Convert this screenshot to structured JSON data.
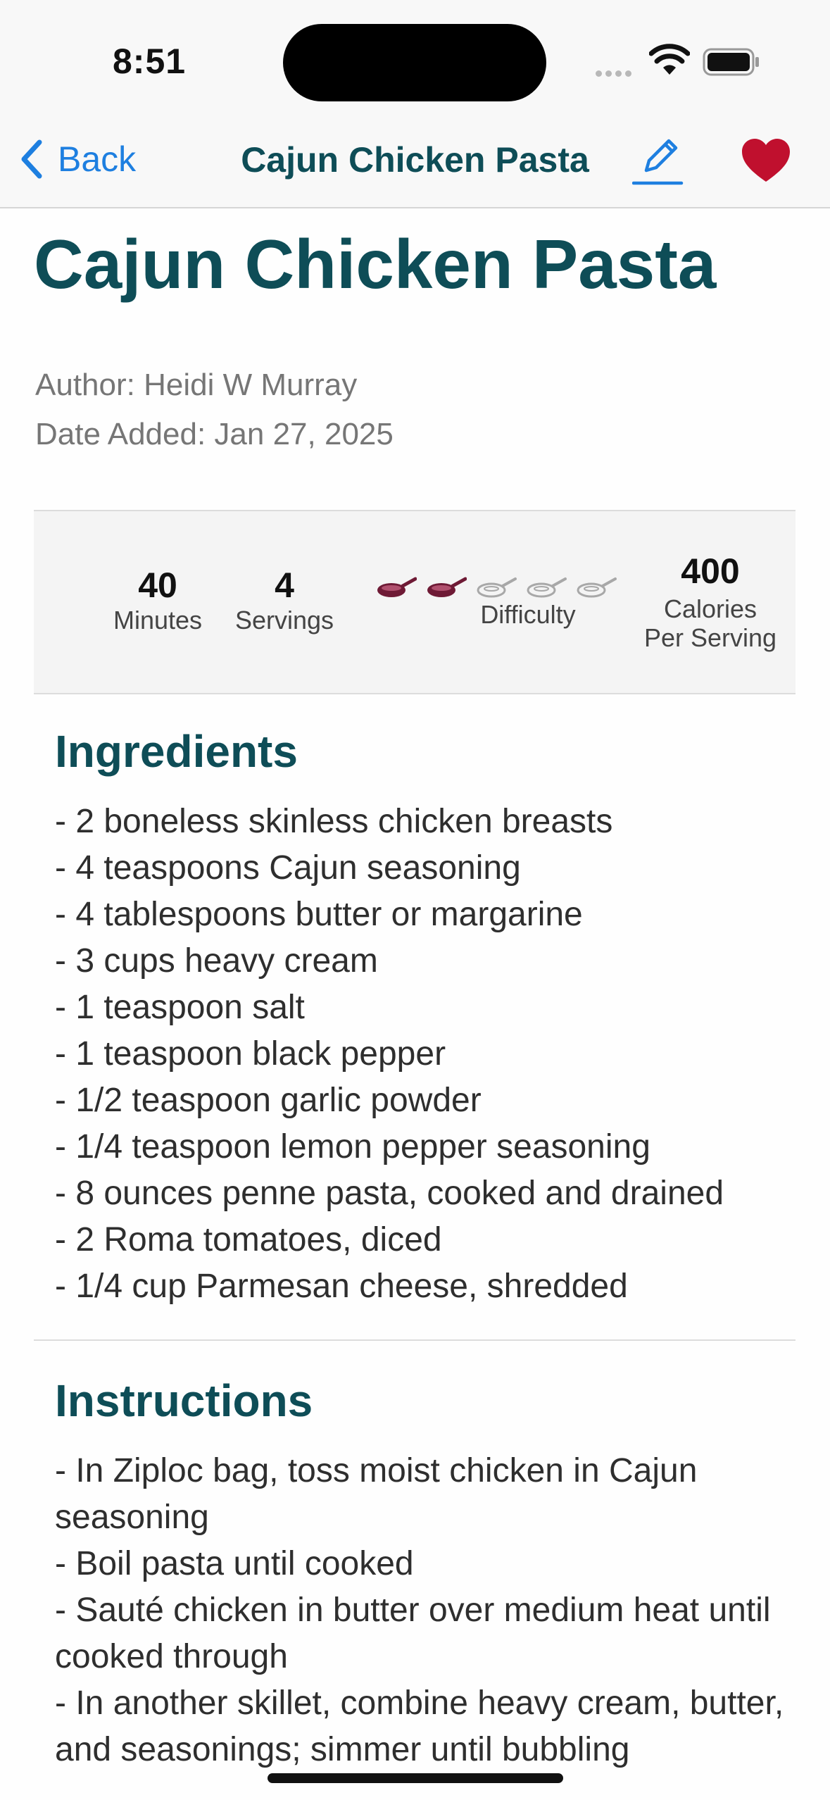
{
  "status_bar": {
    "time": "8:51",
    "icons": [
      "cellular-signal-icon",
      "wifi-icon",
      "battery-icon"
    ]
  },
  "nav": {
    "back_label": "Back",
    "title": "Cajun Chicken Pasta",
    "edit_icon": "pencil-icon",
    "favorite_icon": "heart-icon"
  },
  "recipe": {
    "title": "Cajun Chicken Pasta",
    "author": "Author: Heidi W Murray",
    "date_added": "Date Added: Jan 27, 2025"
  },
  "stats": {
    "minutes_value": "40",
    "minutes_label": "Minutes",
    "servings_value": "4",
    "servings_label": "Servings",
    "difficulty_label": "Difficulty",
    "difficulty_level": 2,
    "difficulty_max": 5,
    "calories_value": "400",
    "calories_label_line1": "Calories",
    "calories_label_line2": "Per Serving"
  },
  "ingredients": {
    "title": "Ingredients",
    "items": [
      "- 2 boneless skinless chicken breasts",
      "- 4 teaspoons Cajun seasoning",
      "- 4 tablespoons butter or margarine",
      "- 3 cups heavy cream",
      "- 1 teaspoon salt",
      "- 1 teaspoon black pepper",
      "- 1/2 teaspoon garlic powder",
      "- 1/4 teaspoon lemon pepper seasoning",
      "- 8 ounces penne pasta, cooked and drained",
      "- 2 Roma tomatoes, diced",
      "- 1/4 cup Parmesan cheese, shredded"
    ]
  },
  "instructions": {
    "title": "Instructions",
    "items": [
      "- In Ziploc bag, toss moist chicken in Cajun seasoning",
      "- Boil pasta until cooked",
      "- Sauté chicken in butter over medium heat until cooked through",
      "- In another skillet, combine heavy cream, butter, and seasonings; simmer until bubbling"
    ]
  },
  "colors": {
    "accent": "#0e4d57",
    "link": "#1e7fe0",
    "heart": "#c0102e",
    "pan_active": "#6e1a35",
    "pan_inactive": "#a8a8a8"
  }
}
